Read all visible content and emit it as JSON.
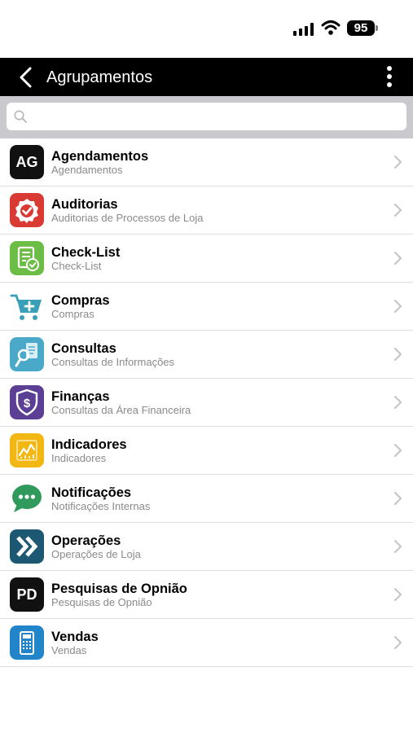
{
  "status_bar": {
    "battery_level": "95"
  },
  "nav": {
    "title": "Agrupamentos"
  },
  "search": {
    "value": "",
    "placeholder": ""
  },
  "icons": {
    "back": "chevron-left-icon",
    "more": "vertical-ellipsis-icon",
    "search": "magnifier-icon",
    "row_chevron": "chevron-right-icon"
  },
  "colors": {
    "nav_background": "#000000",
    "search_background": "#c9c9ce",
    "subtitle_text": "#8a8a8e",
    "chevron": "#c4c4c7"
  },
  "items": [
    {
      "title": "Agendamentos",
      "subtitle": "Agendamentos",
      "icon": "ag-text-icon",
      "icon_text": "AG",
      "color": "#111111"
    },
    {
      "title": "Auditorias",
      "subtitle": "Auditorias de Processos de Loja",
      "icon": "audit-badge-icon",
      "color": "#d93a34"
    },
    {
      "title": "Check-List",
      "subtitle": "Check-List",
      "icon": "checklist-icon",
      "color": "#6cbd45"
    },
    {
      "title": "Compras",
      "subtitle": "Compras",
      "icon": "shopping-cart-icon",
      "color": "#3aa0b8"
    },
    {
      "title": "Consultas",
      "subtitle": "Consultas de Informações",
      "icon": "search-document-icon",
      "color": "#4aa8c9"
    },
    {
      "title": "Finanças",
      "subtitle": "Consultas da Área Financeira",
      "icon": "dollar-shield-icon",
      "color": "#5b3f95"
    },
    {
      "title": "Indicadores",
      "subtitle": "Indicadores",
      "icon": "indicators-chart-icon",
      "color": "#f2b713"
    },
    {
      "title": "Notificações",
      "subtitle": "Notificações Internas",
      "icon": "chat-bubble-icon",
      "color": "#2f9a5b"
    },
    {
      "title": "Operações",
      "subtitle": "Operações de Loja",
      "icon": "fast-forward-icon",
      "color": "#1c5872"
    },
    {
      "title": "Pesquisas de Opnião",
      "subtitle": "Pesquisas de Opnião",
      "icon": "pd-text-icon",
      "icon_text": "PD",
      "color": "#111111"
    },
    {
      "title": "Vendas",
      "subtitle": "Vendas",
      "icon": "calculator-icon",
      "color": "#2385c9"
    }
  ]
}
